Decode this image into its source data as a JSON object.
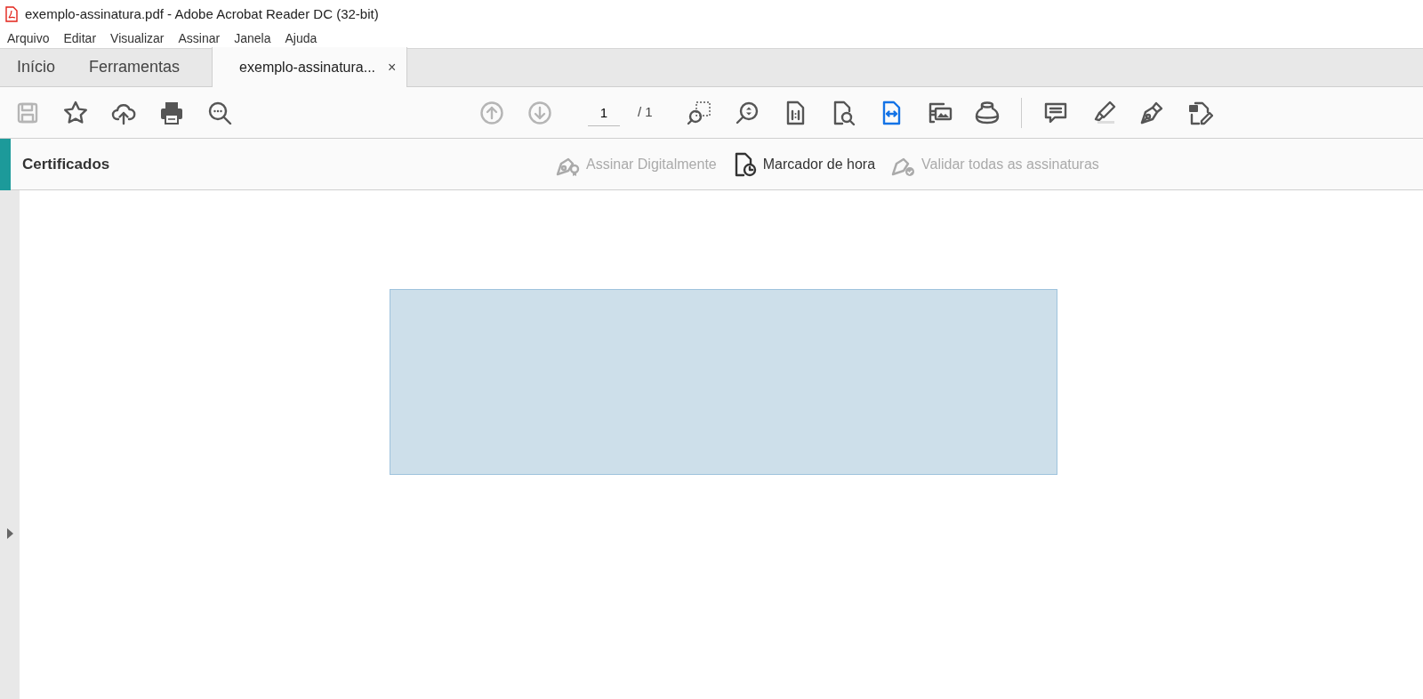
{
  "window": {
    "title": "exemplo-assinatura.pdf - Adobe Acrobat Reader DC (32-bit)"
  },
  "menu": [
    "Arquivo",
    "Editar",
    "Visualizar",
    "Assinar",
    "Janela",
    "Ajuda"
  ],
  "tabs": [
    {
      "label": "Início",
      "selected": false
    },
    {
      "label": "Ferramentas",
      "selected": false
    },
    {
      "label": "exemplo-assinatura...",
      "selected": true,
      "close": "×"
    }
  ],
  "toolbar": {
    "left": [
      {
        "kind": "save",
        "disabled": true
      },
      {
        "kind": "star",
        "disabled": false
      },
      {
        "kind": "upload",
        "disabled": false
      },
      {
        "kind": "print",
        "disabled": false
      },
      {
        "kind": "searchmore",
        "disabled": false
      }
    ],
    "nav": [
      {
        "kind": "up",
        "disabled": true
      },
      {
        "kind": "down",
        "disabled": true
      }
    ],
    "page": {
      "value": "1",
      "total": "/ 1"
    },
    "view": [
      {
        "kind": "marquee",
        "selected": false
      },
      {
        "kind": "zoom",
        "selected": false
      },
      {
        "kind": "actual",
        "selected": false
      },
      {
        "kind": "pagesearch",
        "selected": false
      },
      {
        "kind": "fitwidth",
        "selected": true
      },
      {
        "kind": "images",
        "selected": false
      },
      {
        "kind": "ink",
        "selected": false
      }
    ],
    "tools": [
      {
        "kind": "comment"
      },
      {
        "kind": "highlight"
      },
      {
        "kind": "sign"
      },
      {
        "kind": "fillsign"
      }
    ]
  },
  "panel": {
    "title": "Certificados",
    "actions": [
      {
        "kind": "sign",
        "label": "Assinar Digitalmente",
        "disabled": true
      },
      {
        "kind": "timestamp",
        "label": "Marcador de hora",
        "disabled": false
      },
      {
        "kind": "validate",
        "label": "Validar todas as assinaturas",
        "disabled": true
      }
    ]
  },
  "document": {
    "fields": [
      {
        "kind": "signature"
      }
    ]
  }
}
